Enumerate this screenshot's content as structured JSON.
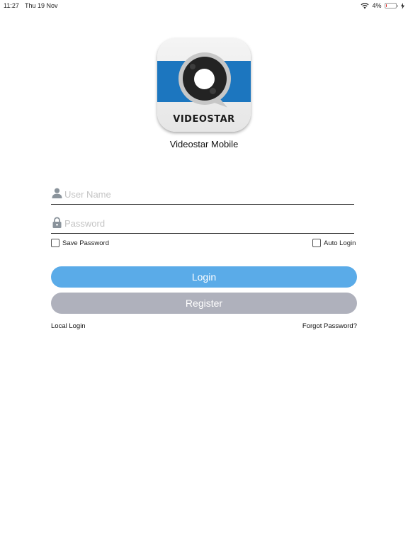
{
  "status_bar": {
    "time": "11:27",
    "date": "Thu 19 Nov",
    "battery_percent": "4%",
    "battery_level": 0.04,
    "icons": [
      "wifi-icon",
      "battery-icon",
      "charging-icon"
    ]
  },
  "logo": {
    "wordmark": "VIDEOSTAR",
    "band_color": "#1c76bf"
  },
  "app_name": "Videostar Mobile",
  "form": {
    "username": {
      "value": "",
      "placeholder": "User Name",
      "icon": "user-icon"
    },
    "password": {
      "value": "",
      "placeholder": "Password",
      "icon": "lock-icon"
    },
    "save_password": {
      "label": "Save Password",
      "checked": false
    },
    "auto_login": {
      "label": "Auto Login",
      "checked": false
    }
  },
  "buttons": {
    "login_label": "Login",
    "register_label": "Register",
    "login_color": "#5aabe8",
    "register_color": "#afb1bc"
  },
  "links": {
    "local_login": "Local Login",
    "forgot_password": "Forgot Password?"
  }
}
